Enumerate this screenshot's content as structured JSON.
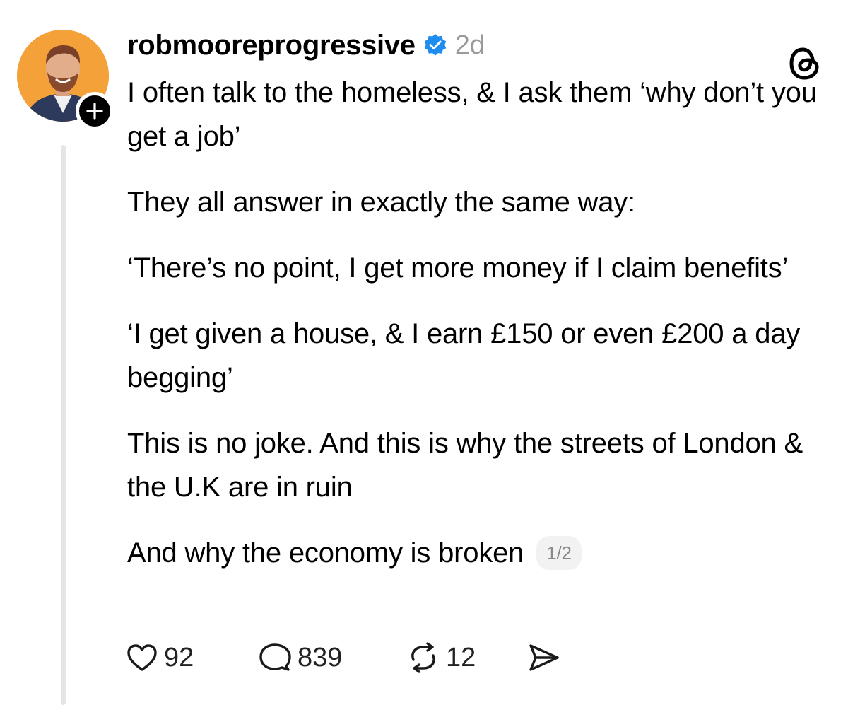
{
  "post": {
    "username": "robmooreprogressive",
    "verified": true,
    "timestamp": "2d",
    "paragraphs": [
      "I often talk to the homeless, & I ask them ‘why don’t you get a job’",
      "They all answer in exactly the same way:",
      "‘There’s no point, I get more money if I claim benefits’",
      "‘I get given a house, & I earn £150 or even £200 a day begging’",
      "This is no joke. And this is why the streets of London & the U.K are in ruin",
      "And why the economy is broken"
    ],
    "page_indicator": "1/2"
  },
  "actions": {
    "likes": "92",
    "replies": "839",
    "reposts": "12"
  },
  "icons": {
    "verified": "verified-badge-icon",
    "app_logo": "threads-logo-icon",
    "follow": "plus-icon",
    "like": "heart-icon",
    "reply": "speech-bubble-icon",
    "repost": "repost-arrows-icon",
    "share": "paper-plane-icon"
  },
  "colors": {
    "verified_blue": "#1f8cf0",
    "avatar_background": "#f4a13a",
    "muted_text": "#9a9a9a",
    "thread_line": "#e5e5e5"
  }
}
